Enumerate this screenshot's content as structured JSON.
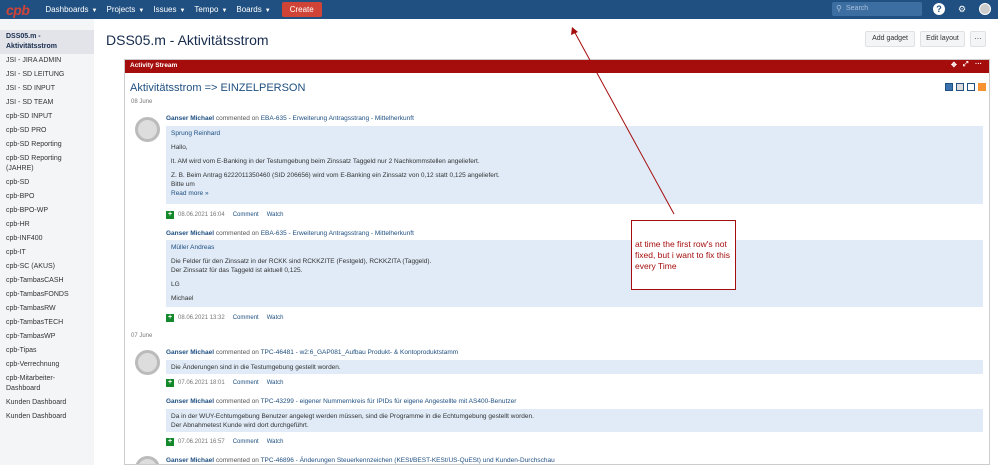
{
  "topbar": {
    "logo": "cpb",
    "nav": [
      "Dashboards",
      "Projects",
      "Issues",
      "Tempo",
      "Boards"
    ],
    "create_label": "Create",
    "search_placeholder": "Search"
  },
  "sidebar": {
    "items": [
      {
        "label": "DSS05.m - Aktivitätsstrom",
        "active": true
      },
      {
        "label": "JSI - JIRA ADMIN"
      },
      {
        "label": "JSI - SD LEITUNG"
      },
      {
        "label": "JSI - SD INPUT"
      },
      {
        "label": "JSI - SD TEAM"
      },
      {
        "label": "cpb-SD INPUT"
      },
      {
        "label": "cpb-SD PRO"
      },
      {
        "label": "cpb-SD Reporting"
      },
      {
        "label": "cpb-SD Reporting (JAHRE)"
      },
      {
        "label": "cpb-SD"
      },
      {
        "label": "cpb-BPO"
      },
      {
        "label": "cpb-BPO-WP"
      },
      {
        "label": "cpb-HR"
      },
      {
        "label": "cpb-INF400"
      },
      {
        "label": "cpb-IT"
      },
      {
        "label": "cpb-SC (AKUS)"
      },
      {
        "label": "cpb-TambasCASH"
      },
      {
        "label": "cpb-TambasFONDS"
      },
      {
        "label": "cpb-TambasRW"
      },
      {
        "label": "cpb-TambasTECH"
      },
      {
        "label": "cpb-TambasWP"
      },
      {
        "label": "cpb-Tipas"
      },
      {
        "label": "cpb-Verrechnung"
      },
      {
        "label": "cpb-Mitarbeiter-Dashboard"
      },
      {
        "label": "Kunden Dashboard"
      },
      {
        "label": "Kunden Dashboard"
      }
    ]
  },
  "page": {
    "title": "DSS05.m - Aktivitätsstrom",
    "add_gadget": "Add gadget",
    "edit_layout": "Edit layout",
    "more": "···"
  },
  "gadget": {
    "title": "Activity Stream",
    "stream_title": "Aktivitätsstrom => EINZELPERSON",
    "dates": [
      "08 June",
      "07 June"
    ],
    "entries": [
      {
        "user": "Ganser Michael",
        "verb": "commented on",
        "link": "EBA-635 - Erweiterung Antragsstrang - Mittelherkunft",
        "comment_author": "Sprung Reinhard",
        "lines": [
          "Hallo,",
          "lt. AM wird vom E-Banking in der Testumgebung beim Zinssatz Taggeld nur 2 Nachkommstellen angeliefert.",
          "Z. B. Beim Antrag 6222011350460 (SID 206656) wird vom E-Banking ein Zinssatz von 0,12 statt 0,125 angeliefert.",
          "Bitte um"
        ],
        "read_more": "Read more »",
        "time": "08.06.2021 16:04",
        "comment": "Comment",
        "watch": "Watch"
      },
      {
        "user": "Ganser Michael",
        "verb": "commented on",
        "link": "EBA-635 - Erweiterung Antragsstrang - Mittelherkunft",
        "comment_author": "Müller Andreas",
        "lines": [
          "Die Felder für den Zinssatz in der RCKK sind RCKKZITE (Festgeld), RCKKZITA (Taggeld).",
          "Der Zinssatz für das Taggeld ist aktuell 0,125.",
          "LG",
          "Michael"
        ],
        "time": "08.06.2021 13:32",
        "comment": "Comment",
        "watch": "Watch"
      },
      {
        "user": "Ganser Michael",
        "verb": "commented on",
        "link": "TPC-46481 - w2:6_GAP081_Aufbau Produkt- & Kontoproduktstamm",
        "lines": [
          "Die Änderungen sind in die Testumgebung gestellt worden."
        ],
        "time": "07.06.2021 18:01",
        "comment": "Comment",
        "watch": "Watch"
      },
      {
        "user": "Ganser Michael",
        "verb": "commented on",
        "link": "TPC-43299 - eigener Nummernkreis für IPIDs für eigene Angestellte mit AS400-Benutzer",
        "lines": [
          "Da in der WUY-Echtumgebung Benutzer angelegt werden müssen, sind die Programme in die Echtumgebung gestellt worden.",
          "Der Abnahmetest Kunde wird dort durchgeführt."
        ],
        "time": "07.06.2021 16:57",
        "comment": "Comment",
        "watch": "Watch"
      },
      {
        "user": "Ganser Michael",
        "verb": "commented on",
        "link": "TPC-46896 - Änderungen Steuerkennzeichen (KESt/BEST-KESt/US-QuESt) und Kunden-Durchschau"
      }
    ]
  },
  "annotation": {
    "text": "at time the first row's not fixed, but i want to fix this every Time",
    "color": "#a50c0c"
  }
}
